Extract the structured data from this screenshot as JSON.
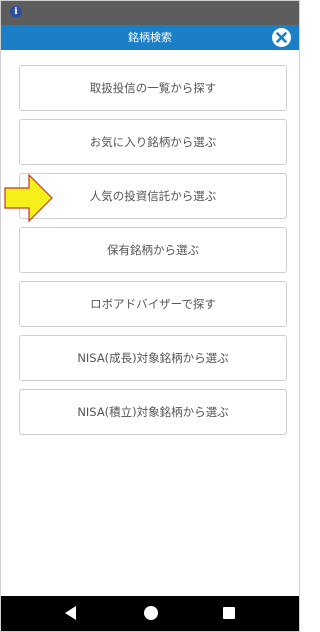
{
  "status_bar": {
    "info_icon": "i"
  },
  "header": {
    "title": "銘柄検索",
    "close_icon": "close-icon"
  },
  "menu": {
    "items": [
      {
        "label": "取扱投信の一覧から探す"
      },
      {
        "label": "お気に入り銘柄から選ぶ"
      },
      {
        "label": "人気の投資信託から選ぶ"
      },
      {
        "label": "保有銘柄から選ぶ"
      },
      {
        "label": "ロボアドバイザーで探す"
      },
      {
        "label": "NISA(成長)対象銘柄から選ぶ"
      },
      {
        "label": "NISA(積立)対象銘柄から選ぶ"
      }
    ]
  },
  "annotation": {
    "arrow_color": "#f5f01a",
    "arrow_border": "#c0392b",
    "highlighted_index": 2
  },
  "nav_bar": {
    "back_icon": "back-triangle-icon",
    "home_icon": "home-circle-icon",
    "recent_icon": "recent-square-icon"
  },
  "colors": {
    "header_bg": "#1a7fc6",
    "status_bg": "#5d5d5d",
    "button_border": "#cfcfcf",
    "button_text": "#555555"
  }
}
